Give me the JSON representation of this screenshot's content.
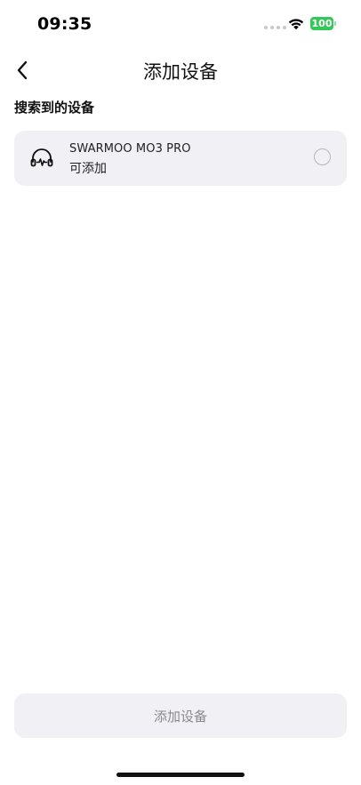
{
  "status_bar": {
    "time": "09:35",
    "battery_level": "100",
    "battery_color": "#34c759"
  },
  "nav": {
    "title": "添加设备",
    "back_icon": "chevron-left-icon"
  },
  "section": {
    "title": "搜索到的设备"
  },
  "devices": [
    {
      "name": "SWARMOO MO3 PRO",
      "status": "可添加",
      "icon": "headphones-icon",
      "selected": false
    }
  ],
  "footer": {
    "add_label": "添加设备"
  }
}
